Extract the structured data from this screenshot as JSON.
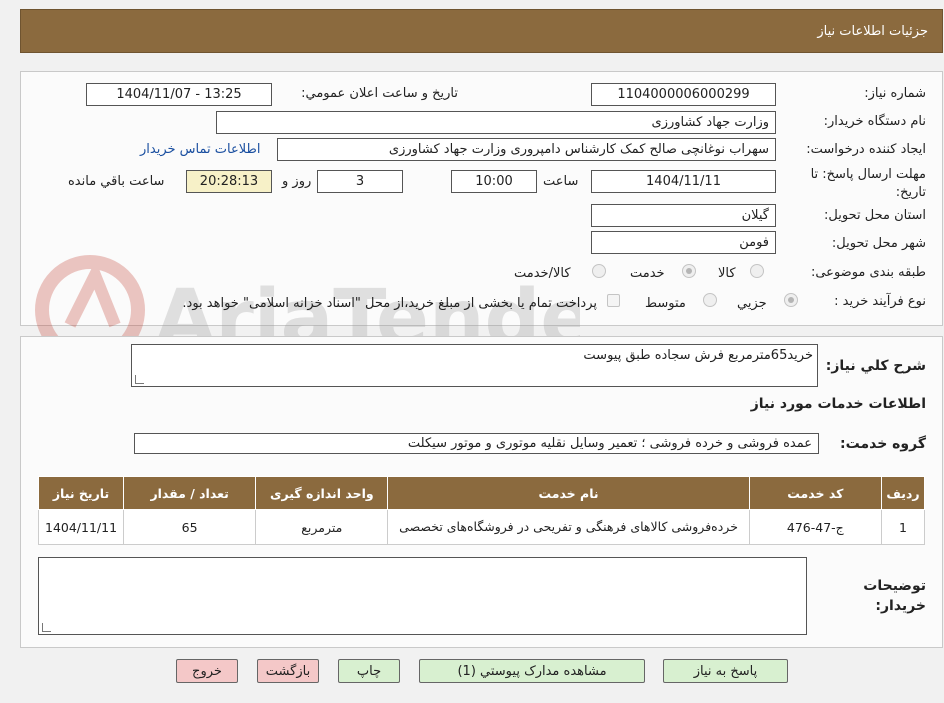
{
  "header": {
    "title": "جزئيات اطلاعات نياز"
  },
  "watermark": {
    "text": "AriaTender.neT"
  },
  "form": {
    "need_number": {
      "label": "شماره نياز:",
      "value": "1104000006000299"
    },
    "announce_datetime": {
      "label": "تاريخ و ساعت اعلان عمومي:",
      "value": "1404/11/07 - 13:25"
    },
    "buyer_org": {
      "label": "نام دستگاه خريدار:",
      "value": "وزارت جهاد کشاورزی"
    },
    "requester": {
      "label": "ايجاد کننده درخواست:",
      "value": "سهراب نوغانچی صالح کمک کارشناس دامپروری وزارت جهاد کشاورزی",
      "contact_link": "اطلاعات تماس خريدار"
    },
    "deadline": {
      "label": "مهلت ارسال پاسخ: تا تاريخ:",
      "date": "1404/11/11",
      "time_label": "ساعت",
      "time": "10:00",
      "days": "3",
      "days_label": "روز و",
      "remaining": "20:28:13",
      "remaining_label": "ساعت باقي مانده"
    },
    "province": {
      "label": "استان محل تحويل:",
      "value": "گیلان"
    },
    "city": {
      "label": "شهر محل تحويل:",
      "value": "فومن"
    },
    "category": {
      "label": "طبقه بندی موضوعی:",
      "options": [
        "کالا",
        "خدمت",
        "کالا/خدمت"
      ],
      "selected": "خدمت"
    },
    "process": {
      "label": "نوع فرآيند خريد :",
      "options": [
        "جزيي",
        "متوسط"
      ],
      "selected": "جزيي",
      "note": "پرداخت تمام یا بخشی از مبلغ خرید،از محل \"اسناد خزانه اسلامی\" خواهد بود."
    }
  },
  "description": {
    "label": "شرح کلي نياز:",
    "value": "خرید65مترمربع فرش سجاده طبق پیوست"
  },
  "services": {
    "title": "اطلاعات خدمات مورد نياز",
    "group_label": "گروه خدمت:",
    "group_value": "عمده فروشی و خرده فروشی ؛ تعمیر وسایل نقلیه موتوری و موتور سیکلت",
    "columns": [
      "رديف",
      "کد خدمت",
      "نام خدمت",
      "واحد اندازه گيری",
      "تعداد / مقدار",
      "تاريخ نياز"
    ],
    "rows": [
      [
        "1",
        "ج-47-476",
        "خرده‌فروشی کالاهای فرهنگی و تفریحی در فروشگاه‌های تخصصی",
        "مترمربع",
        "65",
        "1404/11/11"
      ]
    ]
  },
  "buyer_notes": {
    "label": "توضيحات خريدار:",
    "value": ""
  },
  "buttons": {
    "reply": "پاسخ به نياز",
    "view_docs": "مشاهده مدارک پيوستي (1)",
    "print": "چاپ",
    "back": "بازگشت",
    "exit": "خروج"
  },
  "colors": {
    "header_bg": "#8b6a3e",
    "btn_green": "#d8f0d0",
    "btn_red": "#f4c8c8",
    "link": "#1a4fa0"
  }
}
